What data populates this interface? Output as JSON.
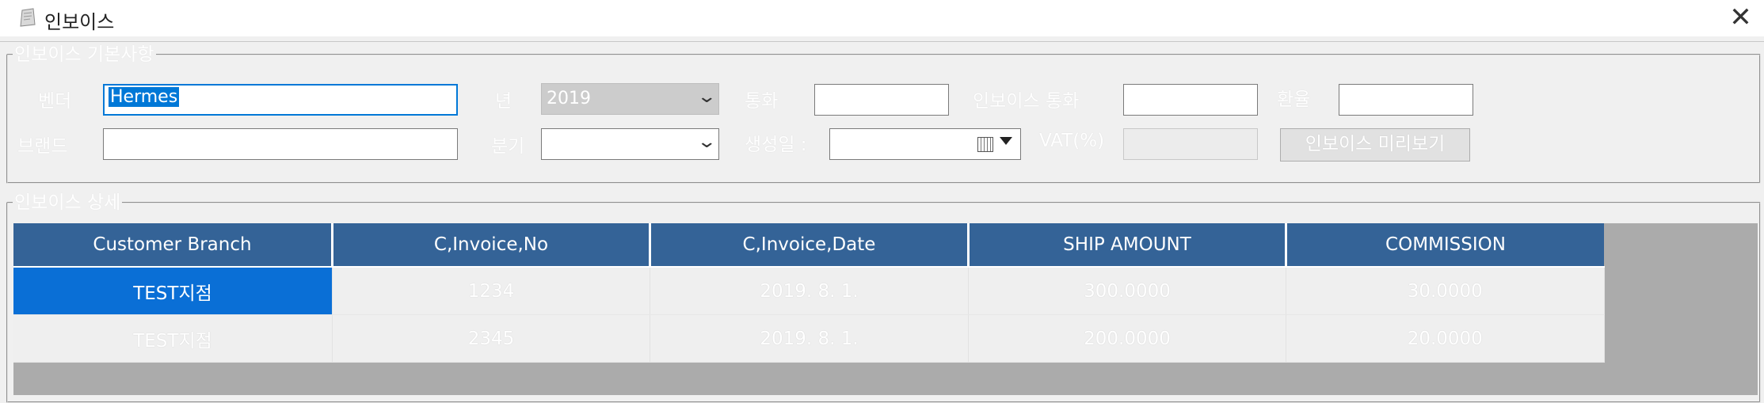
{
  "window": {
    "title": "인보이스",
    "close_glyph": "✕",
    "app_icon": "invoice-app-icon"
  },
  "basic": {
    "legend": "인보이스 기본사항",
    "vendor_label": "벤더",
    "vendor_value": "Hermes",
    "brand_label": "브랜드",
    "brand_value": "",
    "year_label": "년",
    "year_value": "2019",
    "quarter_label": "분기",
    "quarter_value": "",
    "currency_label": "통화",
    "currency_value": "",
    "created_label": "생성일 :",
    "created_value": "",
    "invoice_currency_label": "인보이스 통화",
    "invoice_currency_value": "",
    "vat_label": "VAT(%)",
    "vat_value": "",
    "rate_label": "환율",
    "rate_value": "",
    "preview_button": "인보이스 미리보기",
    "dropdown_glyph": "⌄"
  },
  "detail": {
    "legend": "인보이스 상세",
    "columns": [
      "Customer Branch",
      "C,Invoice,No",
      "C,Invoice,Date",
      "SHIP AMOUNT",
      "COMMISSION"
    ],
    "rows": [
      [
        "TEST지점",
        "1234",
        "2019. 8. 1.",
        "300.0000",
        "30.0000"
      ],
      [
        "TEST지점",
        "2345",
        "2019. 8. 1.",
        "200.0000",
        "20.0000"
      ]
    ],
    "selected_cell": {
      "row": 0,
      "col": 0
    }
  },
  "colors": {
    "header_bg": "#346397",
    "selection": "#0078d7",
    "grid_empty": "#ababab"
  }
}
